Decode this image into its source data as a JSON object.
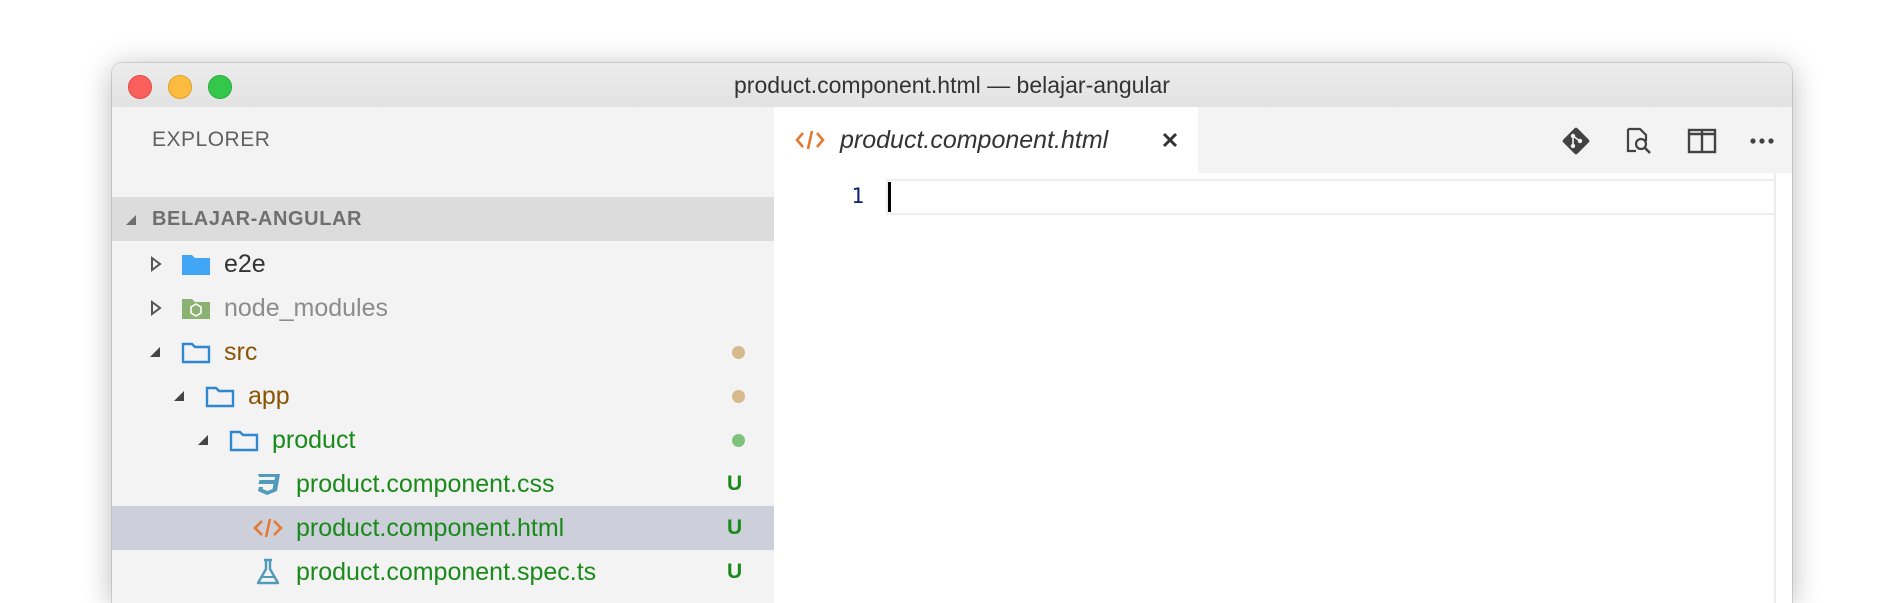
{
  "window": {
    "title": "product.component.html — belajar-angular"
  },
  "sidebar": {
    "explorer_title": "EXPLORER",
    "section_title": "BELAJAR-ANGULAR",
    "items": [
      {
        "label": "e2e",
        "type": "folder",
        "expanded": false,
        "icon": "folder-icon",
        "color": "#333333",
        "status": ""
      },
      {
        "label": "node_modules",
        "type": "folder",
        "expanded": false,
        "icon": "node-modules-icon",
        "color": "#8c8c8c",
        "status": ""
      },
      {
        "label": "src",
        "type": "folder",
        "expanded": true,
        "icon": "folder-open-icon",
        "color": "#895503",
        "status": "dot"
      },
      {
        "label": "app",
        "type": "folder",
        "expanded": true,
        "icon": "folder-open-icon",
        "color": "#895503",
        "status": "dot"
      },
      {
        "label": "product",
        "type": "folder",
        "expanded": true,
        "icon": "folder-open-icon",
        "color": "#1a8a1a",
        "status": "dot"
      },
      {
        "label": "product.component.css",
        "type": "file",
        "icon": "css-file-icon",
        "color": "#1a8a1a",
        "status": "U"
      },
      {
        "label": "product.component.html",
        "type": "file",
        "icon": "html-file-icon",
        "color": "#1a8a1a",
        "status": "U",
        "selected": true
      },
      {
        "label": "product.component.spec.ts",
        "type": "file",
        "icon": "test-file-icon",
        "color": "#1a8a1a",
        "status": "U"
      }
    ]
  },
  "editor": {
    "tab_label": "product.component.html",
    "line_numbers": [
      "1"
    ]
  },
  "toolbar": {
    "icons": [
      "git-compare-icon",
      "open-preview-icon",
      "split-editor-icon",
      "more-actions-icon"
    ]
  },
  "colors": {
    "accent_html": "#e37933",
    "css_icon": "#519aba",
    "folder_blue": "#42a5f5",
    "folder_outline": "#2f88cf",
    "untracked_green": "#1a8a1a",
    "modified_dot": "#d7b98e",
    "untracked_dot": "#7ec27e"
  }
}
